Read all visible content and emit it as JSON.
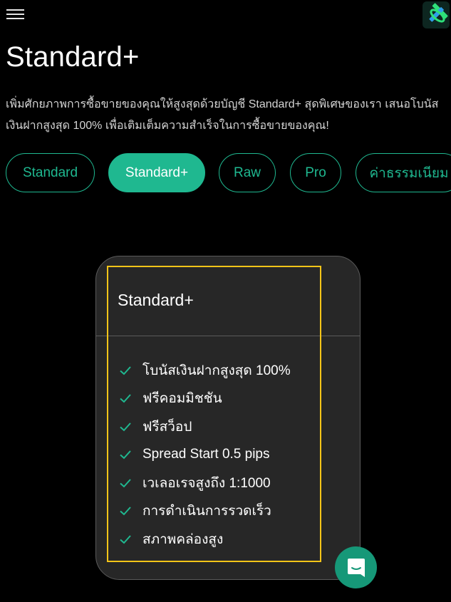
{
  "header": {
    "menu_icon": "hamburger-menu-icon",
    "logo_icon": "brand-logo-icon"
  },
  "page": {
    "title": "Standard+",
    "description": "เพิ่มศักยภาพการซื้อขายของคุณให้สูงสุดด้วยบัญชี Standard+ สุดพิเศษของเรา เสนอโบนัสเงินฝากสูงสุด 100% เพื่อเติมเต็มความสำเร็จในการซื้อขายของคุณ!"
  },
  "tabs": [
    {
      "label": "Standard",
      "active": false
    },
    {
      "label": "Standard+",
      "active": true
    },
    {
      "label": "Raw",
      "active": false
    },
    {
      "label": "Pro",
      "active": false
    },
    {
      "label": "ค่าธรรมเนียม",
      "active": false
    }
  ],
  "card": {
    "title": "Standard+",
    "features": [
      "โบนัสเงินฝากสูงสุด 100%",
      "ฟรีคอมมิชชัน",
      "ฟรีสว็อป",
      "Spread Start 0.5 pips",
      "เวเลอเรจสูงถึง 1:1000",
      "การดำเนินการรวดเร็ว",
      "สภาพคล่องสูง"
    ]
  },
  "colors": {
    "accent": "#1fb890",
    "chat_button": "#169878",
    "highlight": "#f5c518",
    "card_bg": "#272727"
  },
  "chat": {
    "icon": "chat-bubble-icon"
  }
}
